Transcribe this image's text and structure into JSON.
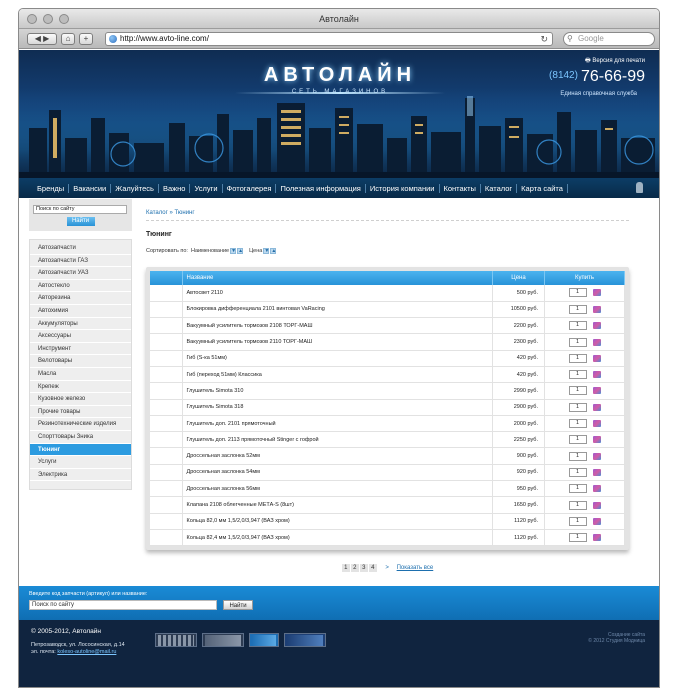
{
  "browser": {
    "title": "Автолайн",
    "url": "http://www.avto-line.com/",
    "search_placeholder": "Google"
  },
  "header": {
    "logo_text": "АВТОЛАЙН",
    "logo_subtitle": "СЕТЬ МАГАЗИНОВ",
    "print_link": "Версия для печати",
    "phone_code": "(8142)",
    "phone_number": "76-66-99",
    "phone_note": "Единая справочная служба"
  },
  "nav": [
    "Бренды",
    "Вакансии",
    "Жалуйтесь",
    "Важно",
    "Услуги",
    "Фотогалерея",
    "Полезная информация",
    "История компании",
    "Контакты",
    "Каталог",
    "Карта сайта"
  ],
  "sidebar": {
    "search_placeholder": "Поиск по сайту",
    "search_button": "Найти",
    "categories": [
      "Автозапчасти",
      "Автозапчасти ГАЗ",
      "Автозапчасти УАЗ",
      "Автостекло",
      "Авторезина",
      "Автохимия",
      "Аккумуляторы",
      "Аксессуары",
      "Инструмент",
      "Велотовары",
      "Масла",
      "Крепеж",
      "Кузовное железо",
      "Прочие товары",
      "Резинотехнические изделия",
      "Спорттовары Зника",
      "Тюнинг",
      "Услуги",
      "Электрика"
    ],
    "active_category": "Тюнинг"
  },
  "main": {
    "breadcrumb": "Каталог » Тюнинг",
    "title": "Тюнинг",
    "sort_label": "Сортировать по:",
    "sort_name": "Наименование",
    "sort_price": "Цена",
    "columns": {
      "name": "Название",
      "price": "Цена",
      "buy": "Купить"
    },
    "products": [
      {
        "name": "Автосвет 2110",
        "price": "500 руб.",
        "qty": "1"
      },
      {
        "name": "Блокировка дифференциала 2101 винтовая VaRacing",
        "price": "10500 руб.",
        "qty": "1"
      },
      {
        "name": "Вакуумный усилитель тормозов 2108 ТОРГ-МАШ",
        "price": "2200 руб.",
        "qty": "1"
      },
      {
        "name": "Вакуумный усилитель тормозов 2110 ТОРГ-МАШ",
        "price": "2300 руб.",
        "qty": "1"
      },
      {
        "name": "Гиб (S-ка 51мм)",
        "price": "420 руб.",
        "qty": "1"
      },
      {
        "name": "Гиб (переход 51мм) Классика",
        "price": "420 руб.",
        "qty": "1"
      },
      {
        "name": "Глушитель Simota 310",
        "price": "2990 руб.",
        "qty": "1"
      },
      {
        "name": "Глушитель Simota 318",
        "price": "2900 руб.",
        "qty": "1"
      },
      {
        "name": "Глушитель доп. 2101 прямоточный",
        "price": "2000 руб.",
        "qty": "1"
      },
      {
        "name": "Глушитель доп. 2113 прямоточный Stinger с гофрой",
        "price": "2250 руб.",
        "qty": "1"
      },
      {
        "name": "Дроссельная заслонка 52мм",
        "price": "900 руб.",
        "qty": "1"
      },
      {
        "name": "Дроссельная заслонка 54мм",
        "price": "920 руб.",
        "qty": "1"
      },
      {
        "name": "Дроссельная заслонка 56мм",
        "price": "950 руб.",
        "qty": "1"
      },
      {
        "name": "Клапана 2108 облегченные МЕТА-S (8шт)",
        "price": "1650 руб.",
        "qty": "1"
      },
      {
        "name": "Кольца 82,0 мм 1,5/2,0/3,947 (ВАЗ хром)",
        "price": "1120 руб.",
        "qty": "1"
      },
      {
        "name": "Кольца 82,4 мм 1,5/2,0/3,947 (ВАЗ хром)",
        "price": "1120 руб.",
        "qty": "1"
      }
    ],
    "pages": [
      "1",
      "2",
      "3",
      "4"
    ],
    "next": ">",
    "show_all": "Показать все"
  },
  "footer_search": {
    "label": "Введите код запчасти (артикул) или название:",
    "placeholder": "Поиск по сайту",
    "button": "Найти"
  },
  "footer": {
    "copyright": "© 2005-2012, Автолайн",
    "address": "Петрозаводск, ул. Лососинская, д.14",
    "email_label": "эл. почта:",
    "email": "koleso-autoline@mail.ru",
    "studio": "Создание сайта\n© 2012 Студия Модница"
  },
  "colors": {
    "accent": "#2c9be0",
    "header_dark": "#0f2c52",
    "nav": "#0a3456"
  }
}
